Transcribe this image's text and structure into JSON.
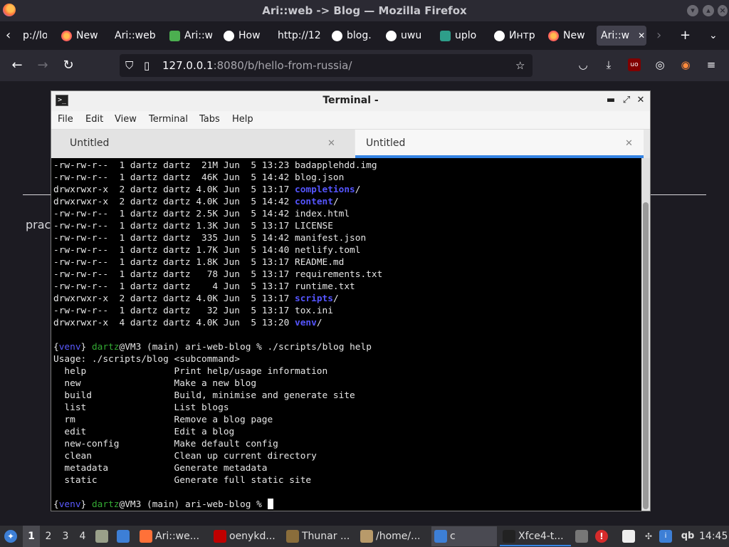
{
  "firefox": {
    "window_title": "Ari::web -> Blog — Mozilla Firefox",
    "tabs": [
      {
        "label": "p://lo",
        "icon": "page-icon"
      },
      {
        "label": "New",
        "icon": "firefox-icon"
      },
      {
        "label": "Ari::web",
        "icon": "none"
      },
      {
        "label": "Ari::w",
        "icon": "puzzle-icon"
      },
      {
        "label": "How",
        "icon": "wikipedia-icon"
      },
      {
        "label": "http://12",
        "icon": "none"
      },
      {
        "label": "blog.",
        "icon": "github-icon"
      },
      {
        "label": "uwu",
        "icon": "google-icon"
      },
      {
        "label": "uplo",
        "icon": "shield-icon"
      },
      {
        "label": "Интр",
        "icon": "google-icon"
      },
      {
        "label": "New",
        "icon": "firefox-icon"
      },
      {
        "label": "Ari::w",
        "icon": "none",
        "active": true
      }
    ],
    "url_host": "127.0.0.1",
    "url_path": ":8080/b/hello-from-russia/"
  },
  "page": {
    "partial_text": "prac"
  },
  "terminal": {
    "title": "Terminal -",
    "menu": [
      "File",
      "Edit",
      "View",
      "Terminal",
      "Tabs",
      "Help"
    ],
    "tabs": [
      {
        "label": "Untitled",
        "active": false
      },
      {
        "label": "Untitled",
        "active": true
      }
    ],
    "listing": [
      {
        "perm": "-rw-rw-r--",
        "links": "1",
        "user": "dartz",
        "group": "dartz",
        "size": "21M",
        "month": "Jun",
        "day": "5",
        "time": "13:23",
        "name": "badapplehdd.img",
        "dir": false
      },
      {
        "perm": "-rw-rw-r--",
        "links": "1",
        "user": "dartz",
        "group": "dartz",
        "size": "46K",
        "month": "Jun",
        "day": "5",
        "time": "14:42",
        "name": "blog.json",
        "dir": false
      },
      {
        "perm": "drwxrwxr-x",
        "links": "2",
        "user": "dartz",
        "group": "dartz",
        "size": "4.0K",
        "month": "Jun",
        "day": "5",
        "time": "13:17",
        "name": "completions",
        "dir": true
      },
      {
        "perm": "drwxrwxr-x",
        "links": "2",
        "user": "dartz",
        "group": "dartz",
        "size": "4.0K",
        "month": "Jun",
        "day": "5",
        "time": "14:42",
        "name": "content",
        "dir": true
      },
      {
        "perm": "-rw-rw-r--",
        "links": "1",
        "user": "dartz",
        "group": "dartz",
        "size": "2.5K",
        "month": "Jun",
        "day": "5",
        "time": "14:42",
        "name": "index.html",
        "dir": false
      },
      {
        "perm": "-rw-rw-r--",
        "links": "1",
        "user": "dartz",
        "group": "dartz",
        "size": "1.3K",
        "month": "Jun",
        "day": "5",
        "time": "13:17",
        "name": "LICENSE",
        "dir": false
      },
      {
        "perm": "-rw-rw-r--",
        "links": "1",
        "user": "dartz",
        "group": "dartz",
        "size": "335",
        "month": "Jun",
        "day": "5",
        "time": "14:42",
        "name": "manifest.json",
        "dir": false
      },
      {
        "perm": "-rw-rw-r--",
        "links": "1",
        "user": "dartz",
        "group": "dartz",
        "size": "1.7K",
        "month": "Jun",
        "day": "5",
        "time": "14:40",
        "name": "netlify.toml",
        "dir": false
      },
      {
        "perm": "-rw-rw-r--",
        "links": "1",
        "user": "dartz",
        "group": "dartz",
        "size": "1.8K",
        "month": "Jun",
        "day": "5",
        "time": "13:17",
        "name": "README.md",
        "dir": false
      },
      {
        "perm": "-rw-rw-r--",
        "links": "1",
        "user": "dartz",
        "group": "dartz",
        "size": "78",
        "month": "Jun",
        "day": "5",
        "time": "13:17",
        "name": "requirements.txt",
        "dir": false
      },
      {
        "perm": "-rw-rw-r--",
        "links": "1",
        "user": "dartz",
        "group": "dartz",
        "size": "4",
        "month": "Jun",
        "day": "5",
        "time": "13:17",
        "name": "runtime.txt",
        "dir": false
      },
      {
        "perm": "drwxrwxr-x",
        "links": "2",
        "user": "dartz",
        "group": "dartz",
        "size": "4.0K",
        "month": "Jun",
        "day": "5",
        "time": "13:17",
        "name": "scripts",
        "dir": true
      },
      {
        "perm": "-rw-rw-r--",
        "links": "1",
        "user": "dartz",
        "group": "dartz",
        "size": "32",
        "month": "Jun",
        "day": "5",
        "time": "13:17",
        "name": "tox.ini",
        "dir": false
      },
      {
        "perm": "drwxrwxr-x",
        "links": "4",
        "user": "dartz",
        "group": "dartz",
        "size": "4.0K",
        "month": "Jun",
        "day": "5",
        "time": "13:20",
        "name": "venv",
        "dir": true
      }
    ],
    "prompt": {
      "venv": "venv",
      "user": "dartz",
      "host": "@VM3",
      "branch": " (main) ",
      "cwd": "ari-web-blog",
      "symbol": " % "
    },
    "command": "./scripts/blog help",
    "usage": "Usage: ./scripts/blog <subcommand>",
    "help": [
      {
        "cmd": "help",
        "desc": "Print help/usage information"
      },
      {
        "cmd": "new",
        "desc": "Make a new blog"
      },
      {
        "cmd": "build",
        "desc": "Build, minimise and generate site"
      },
      {
        "cmd": "list",
        "desc": "List blogs"
      },
      {
        "cmd": "rm",
        "desc": "Remove a blog page"
      },
      {
        "cmd": "edit",
        "desc": "Edit a blog"
      },
      {
        "cmd": "new-config",
        "desc": "Make default config"
      },
      {
        "cmd": "clean",
        "desc": "Clean up current directory"
      },
      {
        "cmd": "metadata",
        "desc": "Generate metadata"
      },
      {
        "cmd": "static",
        "desc": "Generate full static site"
      }
    ]
  },
  "taskbar": {
    "workspaces": [
      "1",
      "2",
      "3",
      "4"
    ],
    "active_workspace": "1",
    "tasks": [
      {
        "label": "Ari::we...",
        "icon": "firefox-icon",
        "color": "#ff7139"
      },
      {
        "label": "oenykd...",
        "icon": "filezilla-icon",
        "color": "#bf0000"
      },
      {
        "label": "Thunar ...",
        "icon": "folder-icon",
        "color": "#8a6d3b"
      },
      {
        "label": "/home/...",
        "icon": "archive-icon",
        "color": "#b89a6a"
      },
      {
        "label": "c",
        "icon": "window-icon",
        "color": "#3d7fd6"
      },
      {
        "label": "Xfce4-t...",
        "icon": "terminal-icon",
        "color": "#222222"
      }
    ],
    "tray_label": "qb",
    "clock": "14:45"
  }
}
